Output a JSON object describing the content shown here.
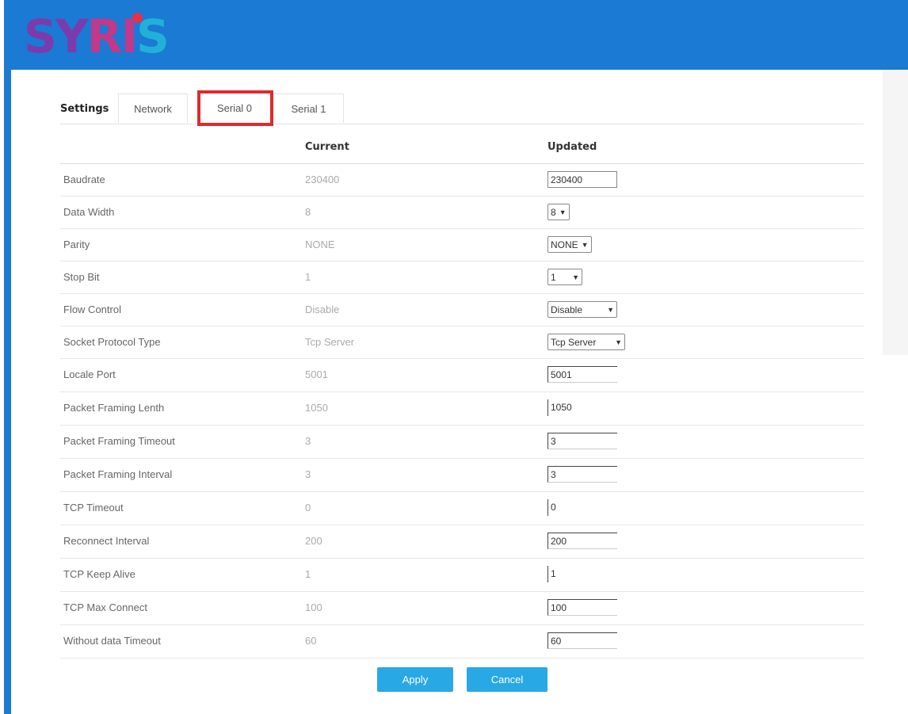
{
  "brand": {
    "logo_text": "SYRIS"
  },
  "tabs": {
    "settings_label": "Settings",
    "items": [
      {
        "label": "Network"
      },
      {
        "label": "Serial 0",
        "selected": true
      },
      {
        "label": "Serial 1"
      }
    ]
  },
  "table": {
    "col_current": "Current",
    "col_updated": "Updated",
    "rows": [
      {
        "label": "Baudrate",
        "current": "230400",
        "updated": "230400",
        "control": "text"
      },
      {
        "label": "Data Width",
        "current": "8",
        "updated": "8",
        "control": "select"
      },
      {
        "label": "Parity",
        "current": "NONE",
        "updated": "NONE",
        "control": "select"
      },
      {
        "label": "Stop Bit",
        "current": "1",
        "updated": "1",
        "control": "select"
      },
      {
        "label": "Flow Control",
        "current": "Disable",
        "updated": "Disable",
        "control": "select"
      },
      {
        "label": "Socket Protocol Type",
        "current": "Tcp Server",
        "updated": "Tcp Server",
        "control": "select"
      },
      {
        "label": "Locale Port",
        "current": "5001",
        "updated": "5001",
        "control": "text"
      },
      {
        "label": "Packet Framing Lenth",
        "current": "1050",
        "updated": "1050",
        "control": "text"
      },
      {
        "label": "Packet Framing Timeout",
        "current": "3",
        "updated": "3",
        "control": "text"
      },
      {
        "label": "Packet Framing Interval",
        "current": "3",
        "updated": "3",
        "control": "text"
      },
      {
        "label": "TCP Timeout",
        "current": "0",
        "updated": "0",
        "control": "text"
      },
      {
        "label": "Reconnect Interval",
        "current": "200",
        "updated": "200",
        "control": "text"
      },
      {
        "label": "TCP Keep Alive",
        "current": "1",
        "updated": "1",
        "control": "text"
      },
      {
        "label": "TCP Max Connect",
        "current": "100",
        "updated": "100",
        "control": "text"
      },
      {
        "label": "Without data Timeout",
        "current": "60",
        "updated": "60",
        "control": "text"
      }
    ]
  },
  "actions": {
    "apply_label": "Apply",
    "cancel_label": "Cancel"
  },
  "colors": {
    "header": "#1a7ad4",
    "button": "#29a8e6",
    "highlight": "#e02a2a"
  }
}
